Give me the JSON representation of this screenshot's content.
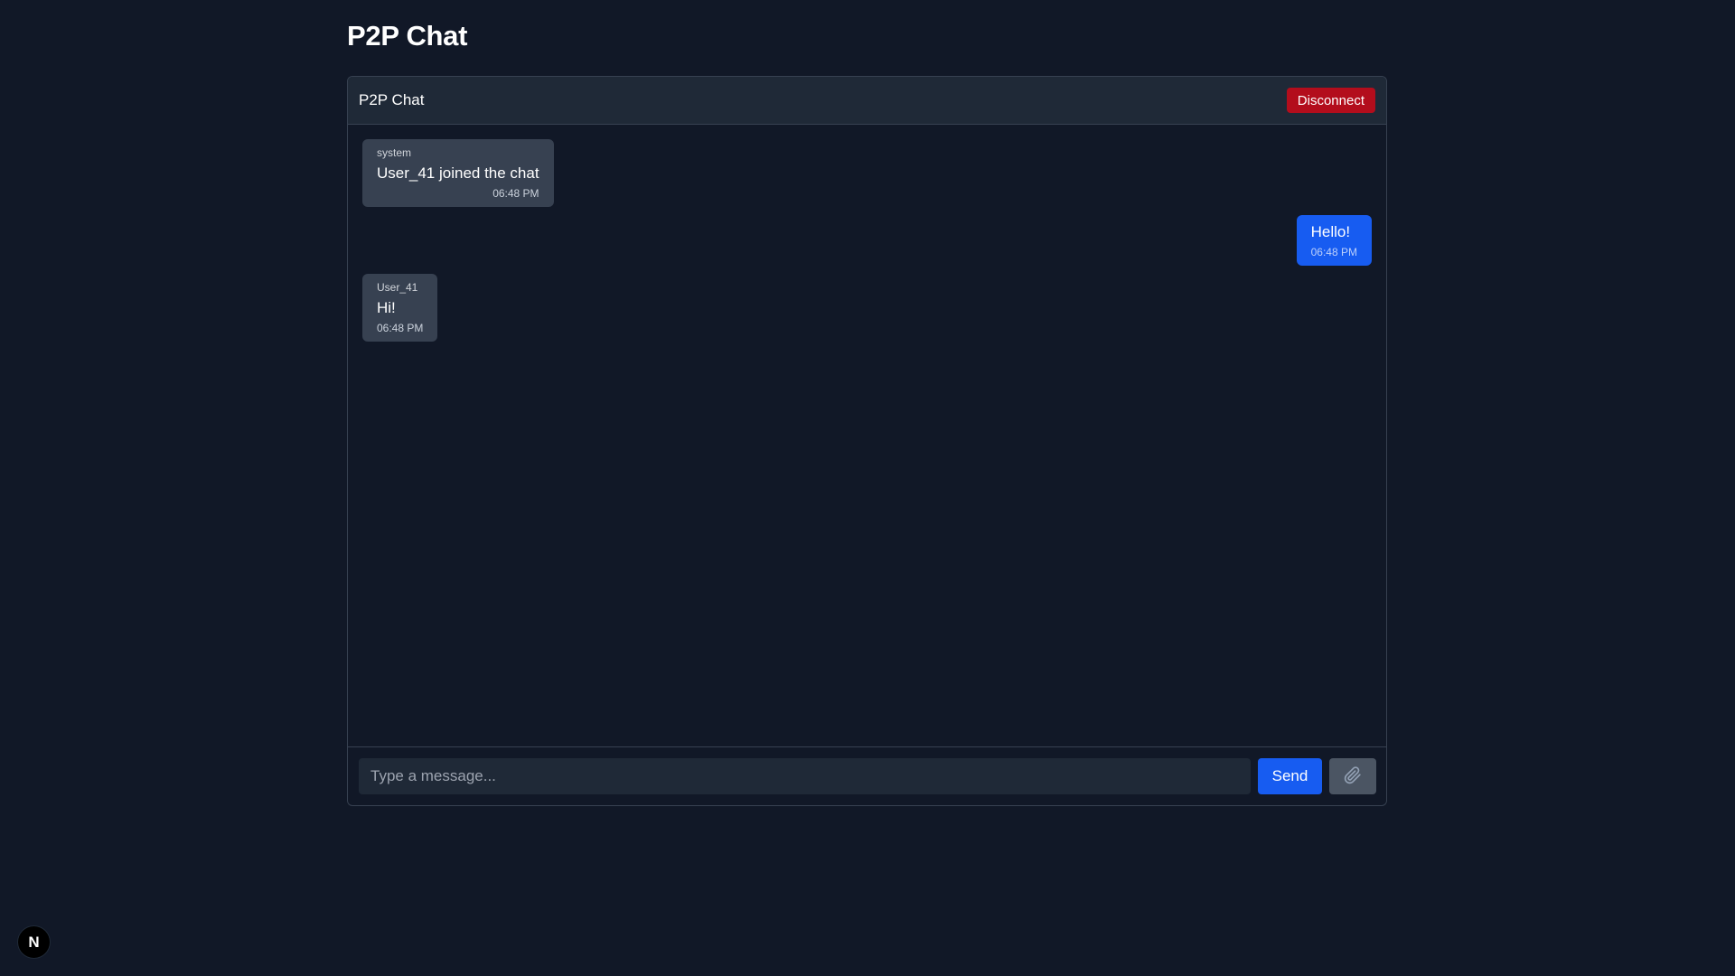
{
  "page": {
    "title": "P2P Chat"
  },
  "chat": {
    "header_title": "P2P Chat",
    "disconnect_label": "Disconnect",
    "messages": [
      {
        "sender": "system",
        "text": "User_41 joined the chat",
        "time": "06:48 PM",
        "own": false
      },
      {
        "sender": "",
        "text": "Hello!",
        "time": "06:48 PM",
        "own": true
      },
      {
        "sender": "User_41",
        "text": "Hi!",
        "time": "06:48 PM",
        "own": false
      }
    ]
  },
  "composer": {
    "placeholder": "Type a message...",
    "value": "",
    "send_label": "Send",
    "attach_icon": "paperclip-icon"
  },
  "dev_badge": {
    "label": "N",
    "icon": "nextjs-logo-icon"
  },
  "colors": {
    "background": "#111827",
    "header": "#1f2937",
    "own_bubble": "#175cf1",
    "other_bubble": "#374151",
    "disconnect": "#b30d1c",
    "attach": "#4b5563"
  }
}
